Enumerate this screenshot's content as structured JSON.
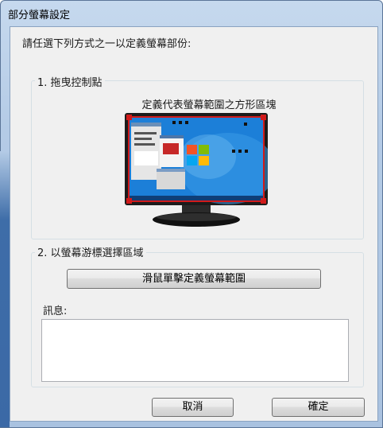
{
  "window": {
    "title": "部分螢幕設定"
  },
  "instruction": "請任選下列方式之一以定義螢幕部份:",
  "group1": {
    "label": "1. 拖曳控制點",
    "caption": "定義代表螢幕範圍之方形區塊"
  },
  "group2": {
    "label": "2. 以螢幕游標選擇區域",
    "define_button": "滑鼠單擊定義螢幕範圍",
    "message_label": "訊息:",
    "message_value": ""
  },
  "buttons": {
    "cancel": "取消",
    "ok": "確定"
  },
  "colors": {
    "selection_red": "#d11a1a",
    "desktop_blue": "#1c7fd8",
    "titlebar": "#b4cbe6"
  }
}
